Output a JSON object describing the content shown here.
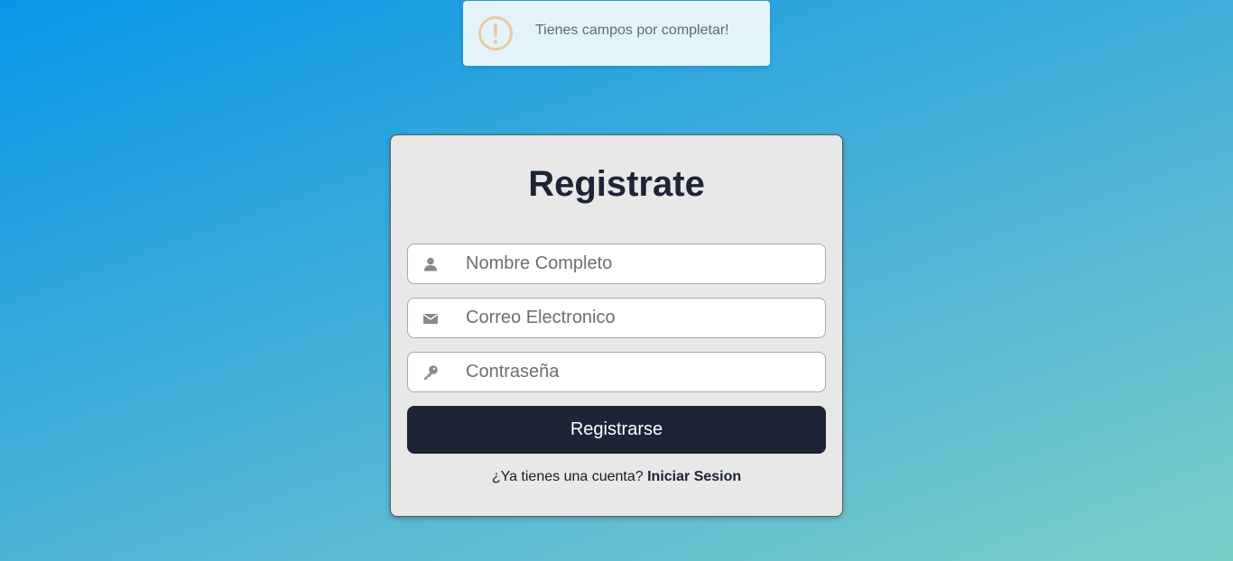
{
  "toast": {
    "icon": "exclamation-circle-icon",
    "icon_color": "#e8c9a0",
    "message": "Tienes campos por completar!"
  },
  "form": {
    "title": "Registrate",
    "fields": [
      {
        "icon": "user-icon",
        "placeholder": "Nombre Completo"
      },
      {
        "icon": "envelope-icon",
        "placeholder": "Correo Electronico"
      },
      {
        "icon": "key-icon",
        "placeholder": "Contraseña"
      }
    ],
    "submit_label": "Registrarse",
    "footer_text": "¿Ya tienes una cuenta?",
    "login_link": "Iniciar Sesion"
  },
  "colors": {
    "primary": "#1c2436",
    "card_bg": "#e8e8e8",
    "icon_gray": "#8a8a8a"
  }
}
